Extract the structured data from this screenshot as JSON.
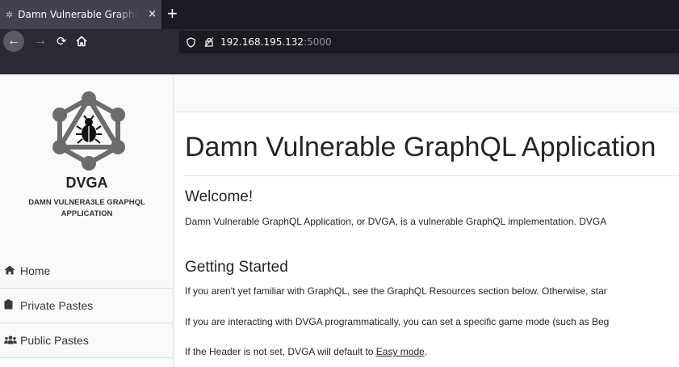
{
  "browser": {
    "tab_title": "Damn Vulnerable GraphQL Application",
    "tab_close": "×",
    "new_tab": "+",
    "url_host": "192.168.195.132",
    "url_port": ":5000",
    "icons": {
      "back": "arrow-left-icon",
      "forward": "arrow-right-icon",
      "reload": "reload-icon",
      "home": "home-icon",
      "shield": "shield-icon",
      "insecure": "insecure-lock-icon"
    }
  },
  "sidebar": {
    "brand": "DVGA",
    "tagline_line1": "DAMN VULNERA3LE GRAPHQL",
    "tagline_line2": "APPLICATION",
    "items": [
      {
        "label": "Home",
        "icon": "home-icon"
      },
      {
        "label": "Private Pastes",
        "icon": "clipboard-icon"
      },
      {
        "label": "Public Pastes",
        "icon": "users-icon"
      }
    ]
  },
  "main": {
    "title": "Damn Vulnerable GraphQL Application",
    "welcome_heading": "Welcome!",
    "welcome_text": "Damn Vulnerable GraphQL Application, or DVGA, is a vulnerable GraphQL implementation. DVGA",
    "getting_started_heading": "Getting Started",
    "gs_p1": "If you aren't yet familiar with GraphQL, see the GraphQL Resources section below. Otherwise, star",
    "gs_p2": "If you are interacting with DVGA programmatically, you can set a specific game mode (such as Beg",
    "gs_p3_prefix": "If the Header is not set, DVGA will default to ",
    "gs_p3_link": "Easy mode",
    "gs_p3_suffix": "."
  },
  "colors": {
    "tabbar": "#1c1b22",
    "toolbar": "#2b2a33",
    "sidebar_bg": "#f8f9fa",
    "logo_gray": "#6c6c6c"
  }
}
